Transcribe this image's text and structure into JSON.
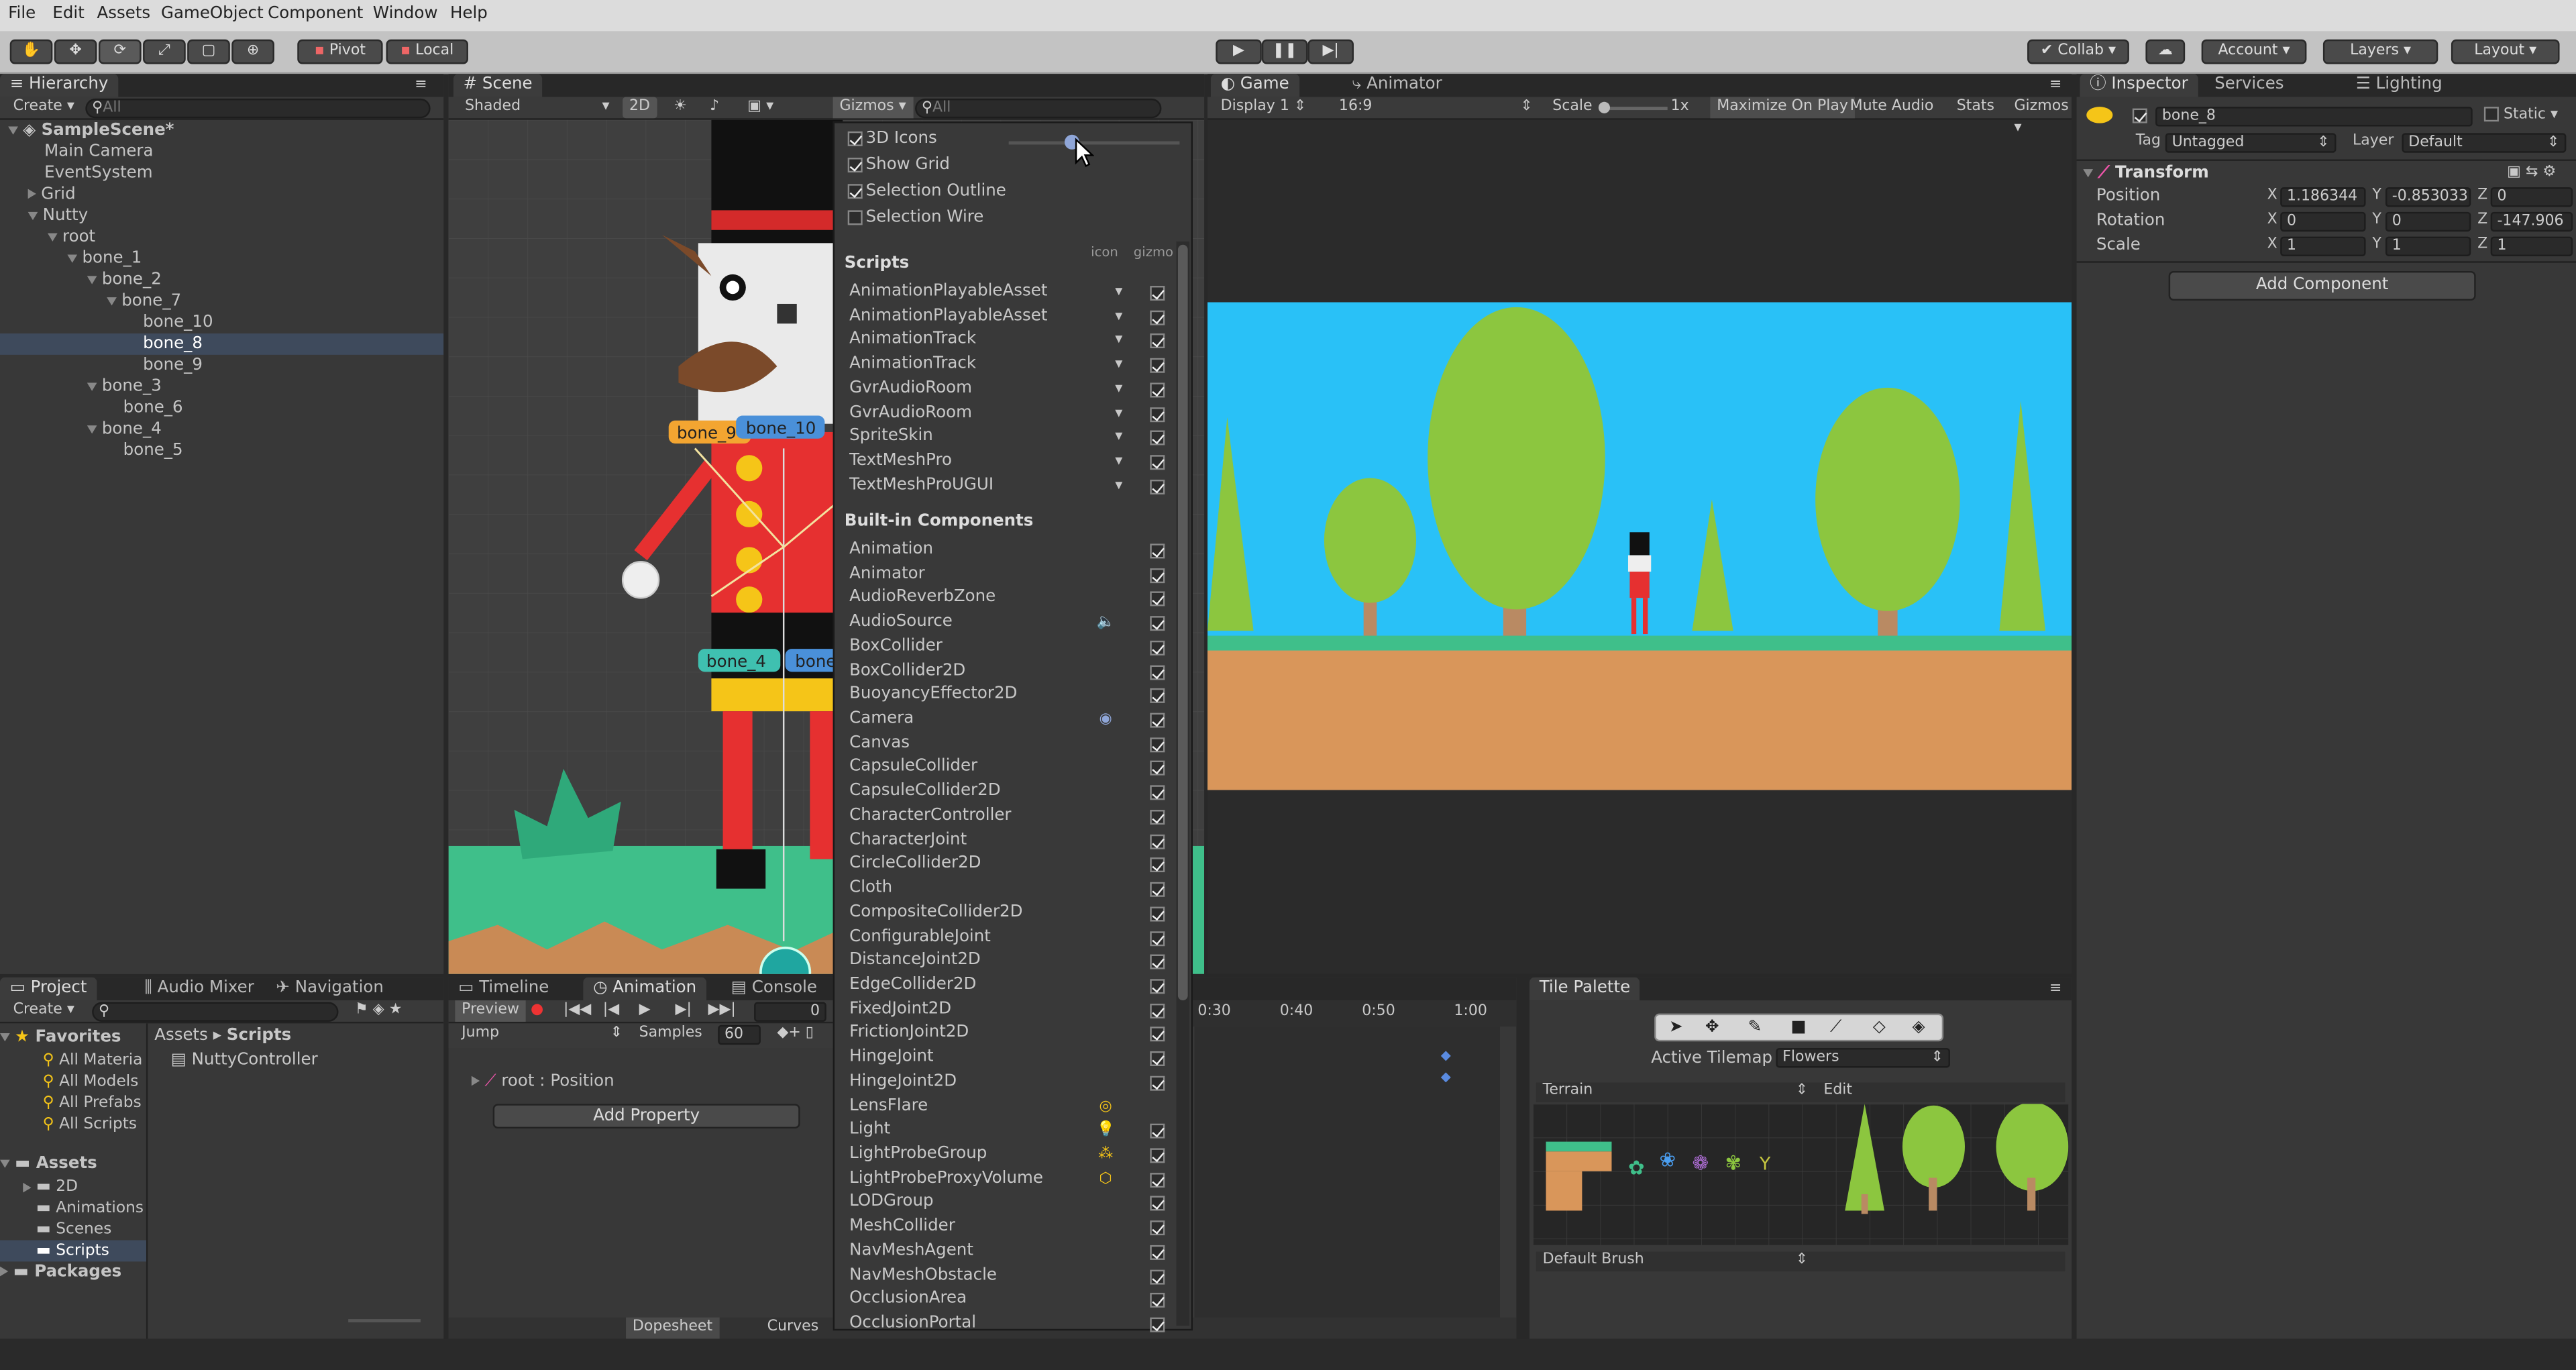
{
  "menu": [
    "File",
    "Edit",
    "Assets",
    "GameObject",
    "Component",
    "Window",
    "Help"
  ],
  "toolbar": {
    "pivot": "Pivot",
    "local": "Local",
    "collab": "Collab",
    "account": "Account",
    "layers": "Layers",
    "layout": "Layout"
  },
  "hierarchy": {
    "tab": "Hierarchy",
    "create": "Create",
    "search_placeholder": "All",
    "rows": [
      {
        "label": "SampleScene*",
        "indent": 0,
        "arrow": "down",
        "bold": true
      },
      {
        "label": "Main Camera",
        "indent": 1,
        "arrow": ""
      },
      {
        "label": "EventSystem",
        "indent": 1,
        "arrow": ""
      },
      {
        "label": "Grid",
        "indent": 1,
        "arrow": "right"
      },
      {
        "label": "Nutty",
        "indent": 1,
        "arrow": "down"
      },
      {
        "label": "root",
        "indent": 2,
        "arrow": "down"
      },
      {
        "label": "bone_1",
        "indent": 3,
        "arrow": "down"
      },
      {
        "label": "bone_2",
        "indent": 4,
        "arrow": "down"
      },
      {
        "label": "bone_7",
        "indent": 5,
        "arrow": "down"
      },
      {
        "label": "bone_10",
        "indent": 6,
        "arrow": ""
      },
      {
        "label": "bone_8",
        "indent": 6,
        "arrow": "",
        "selected": true
      },
      {
        "label": "bone_9",
        "indent": 6,
        "arrow": ""
      },
      {
        "label": "bone_3",
        "indent": 4,
        "arrow": "down"
      },
      {
        "label": "bone_6",
        "indent": 5,
        "arrow": ""
      },
      {
        "label": "bone_4",
        "indent": 4,
        "arrow": "down"
      },
      {
        "label": "bone_5",
        "indent": 5,
        "arrow": ""
      }
    ]
  },
  "scene": {
    "tab": "Scene",
    "shaded": "Shaded",
    "mode2d": "2D",
    "gizmos": "Gizmos",
    "search_placeholder": "All",
    "bone_labels": [
      "bone_9",
      "bone_10",
      "bone_4",
      "bone_"
    ]
  },
  "gizmos_menu": {
    "options": [
      {
        "label": "3D Icons",
        "checked": true
      },
      {
        "label": "Show Grid",
        "checked": true
      },
      {
        "label": "Selection Outline",
        "checked": true
      },
      {
        "label": "Selection Wire",
        "checked": false
      }
    ],
    "scripts_header": "Scripts",
    "col_icon": "icon",
    "col_gizmo": "gizmo",
    "scripts": [
      "AnimationPlayableAsset",
      "AnimationPlayableAsset",
      "AnimationTrack",
      "AnimationTrack",
      "GvrAudioRoom",
      "GvrAudioRoom",
      "SpriteSkin",
      "TextMeshPro",
      "TextMeshProUGUI"
    ],
    "builtin_header": "Built-in Components",
    "builtin": [
      {
        "label": "Animation",
        "icon": "",
        "checked": true
      },
      {
        "label": "Animator",
        "icon": "",
        "checked": true
      },
      {
        "label": "AudioReverbZone",
        "icon": "",
        "checked": true
      },
      {
        "label": "AudioSource",
        "icon": "speaker-icon",
        "checked": true
      },
      {
        "label": "BoxCollider",
        "icon": "",
        "checked": true
      },
      {
        "label": "BoxCollider2D",
        "icon": "",
        "checked": true
      },
      {
        "label": "BuoyancyEffector2D",
        "icon": "",
        "checked": true
      },
      {
        "label": "Camera",
        "icon": "camera-icon",
        "checked": true
      },
      {
        "label": "Canvas",
        "icon": "",
        "checked": true
      },
      {
        "label": "CapsuleCollider",
        "icon": "",
        "checked": true
      },
      {
        "label": "CapsuleCollider2D",
        "icon": "",
        "checked": true
      },
      {
        "label": "CharacterController",
        "icon": "",
        "checked": true
      },
      {
        "label": "CharacterJoint",
        "icon": "",
        "checked": true
      },
      {
        "label": "CircleCollider2D",
        "icon": "",
        "checked": true
      },
      {
        "label": "Cloth",
        "icon": "",
        "checked": true
      },
      {
        "label": "CompositeCollider2D",
        "icon": "",
        "checked": true
      },
      {
        "label": "ConfigurableJoint",
        "icon": "",
        "checked": true
      },
      {
        "label": "DistanceJoint2D",
        "icon": "",
        "checked": true
      },
      {
        "label": "EdgeCollider2D",
        "icon": "",
        "checked": true
      },
      {
        "label": "FixedJoint2D",
        "icon": "",
        "checked": true
      },
      {
        "label": "FrictionJoint2D",
        "icon": "",
        "checked": true
      },
      {
        "label": "HingeJoint",
        "icon": "",
        "checked": true
      },
      {
        "label": "HingeJoint2D",
        "icon": "",
        "checked": true
      },
      {
        "label": "LensFlare",
        "icon": "lensflare-icon",
        "checked": false
      },
      {
        "label": "Light",
        "icon": "light-icon",
        "checked": true
      },
      {
        "label": "LightProbeGroup",
        "icon": "probe-icon",
        "checked": true
      },
      {
        "label": "LightProbeProxyVolume",
        "icon": "proxy-icon",
        "checked": true
      },
      {
        "label": "LODGroup",
        "icon": "",
        "checked": true
      },
      {
        "label": "MeshCollider",
        "icon": "",
        "checked": true
      },
      {
        "label": "NavMeshAgent",
        "icon": "",
        "checked": true
      },
      {
        "label": "NavMeshObstacle",
        "icon": "",
        "checked": true
      },
      {
        "label": "OcclusionArea",
        "icon": "",
        "checked": true
      },
      {
        "label": "OcclusionPortal",
        "icon": "",
        "checked": true
      }
    ]
  },
  "game": {
    "tab": "Game",
    "animator_tab": "Animator",
    "display": "Display 1",
    "aspect": "16:9",
    "scale_label": "Scale",
    "scale_value": "1x",
    "maximize": "Maximize On Play",
    "mute": "Mute Audio",
    "stats": "Stats",
    "gizmos": "Gizmos"
  },
  "inspector": {
    "tab": "Inspector",
    "services_tab": "Services",
    "lighting_tab": "Lighting",
    "object_name": "bone_8",
    "static": "Static",
    "tag_label": "Tag",
    "tag_value": "Untagged",
    "layer_label": "Layer",
    "layer_value": "Default",
    "transform": "Transform",
    "position": {
      "label": "Position",
      "x": "1.186344",
      "y": "-0.853033",
      "z": "0"
    },
    "rotation": {
      "label": "Rotation",
      "x": "0",
      "y": "0",
      "z": "-147.906"
    },
    "scale": {
      "label": "Scale",
      "x": "1",
      "y": "1",
      "z": "1"
    },
    "add_component": "Add Component"
  },
  "project": {
    "tabs": [
      "Project",
      "Audio Mixer",
      "Navigation"
    ],
    "create": "Create",
    "favorites": "Favorites",
    "fav_items": [
      "All Materia",
      "All Models",
      "All Prefabs",
      "All Scripts"
    ],
    "assets": "Assets",
    "asset_items": [
      "2D",
      "Animations",
      "Scenes",
      "Scripts"
    ],
    "packages": "Packages",
    "breadcrumb_root": "Assets",
    "breadcrumb_leaf": "Scripts",
    "files": [
      "NuttyController"
    ]
  },
  "animation": {
    "tabs": [
      "Timeline",
      "Animation",
      "Console"
    ],
    "preview": "Preview",
    "frame": "0",
    "jump": "Jump",
    "samples_label": "Samples",
    "samples_value": "60",
    "property": "root : Position",
    "add_property": "Add Property",
    "dopesheet": "Dopesheet",
    "curves": "Curves",
    "ruler": [
      "0:30",
      "0:40",
      "0:50",
      "1:00"
    ]
  },
  "tile_palette": {
    "tab": "Tile Palette",
    "active_tilemap_label": "Active Tilemap",
    "active_tilemap": "Flowers",
    "palette": "Terrain",
    "edit": "Edit",
    "brush": "Default Brush"
  },
  "colors": {
    "sky": "#29c1f7",
    "grass": "#3fbf8a",
    "dirt": "#d9965a",
    "tree": "#8cc63f",
    "trunk": "#b98a63"
  }
}
